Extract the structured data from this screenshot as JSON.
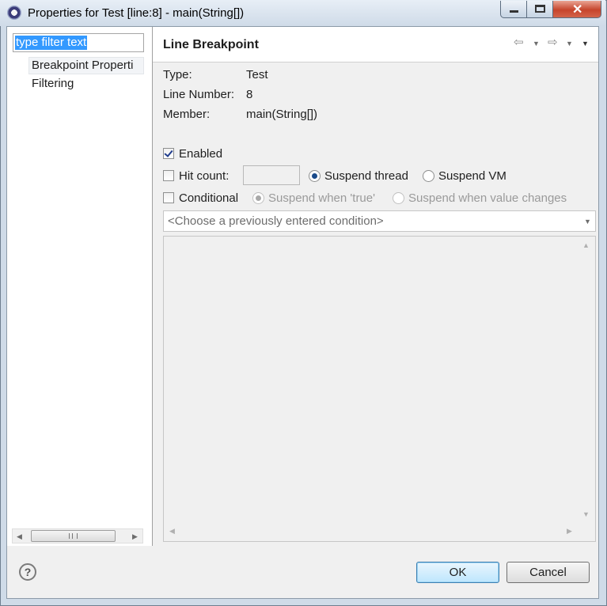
{
  "window": {
    "title": "Properties for Test [line:8] - main(String[])"
  },
  "filter": {
    "value": "type filter text"
  },
  "tree": {
    "items": [
      "Breakpoint Properti",
      "Filtering"
    ]
  },
  "page": {
    "title": "Line Breakpoint"
  },
  "info": {
    "type_label": "Type:",
    "type_value": "Test",
    "line_label": "Line Number:",
    "line_value": "8",
    "member_label": "Member:",
    "member_value": "main(String[])"
  },
  "options": {
    "enabled": "Enabled",
    "hit_count": "Hit count:",
    "suspend_thread": "Suspend thread",
    "suspend_vm": "Suspend VM",
    "conditional": "Conditional",
    "suspend_true": "Suspend when 'true'",
    "suspend_changes": "Suspend when value changes"
  },
  "condition": {
    "placeholder": "<Choose a previously entered condition>"
  },
  "buttons": {
    "ok": "OK",
    "cancel": "Cancel",
    "help": "?"
  },
  "icons": {
    "min": "—",
    "back": "⇦",
    "fwd": "⇨",
    "down": "▼",
    "close": "✕"
  }
}
